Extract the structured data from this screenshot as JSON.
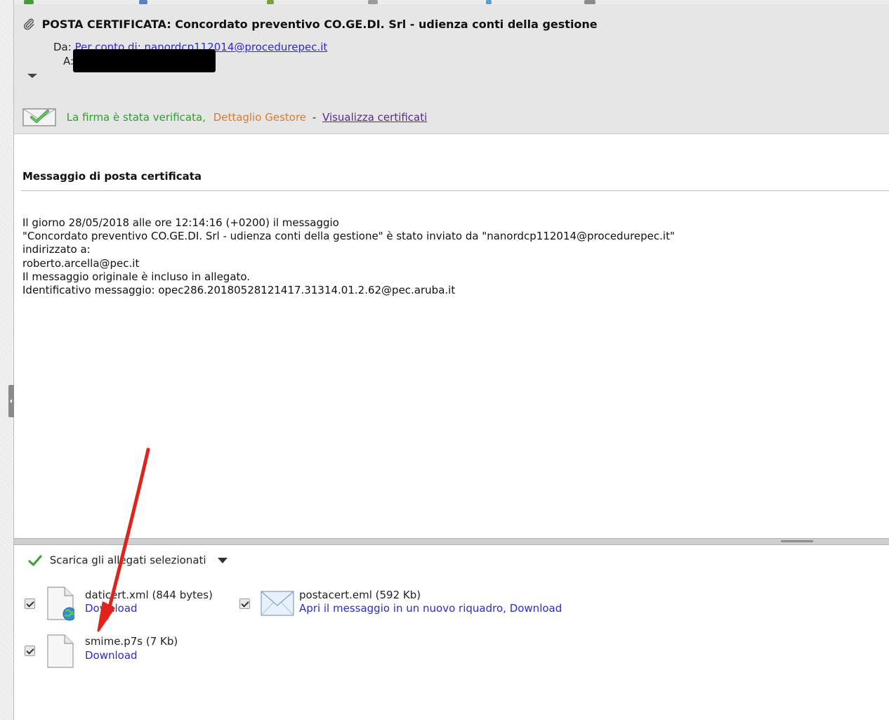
{
  "header": {
    "subject": "POSTA CERTIFICATA: Concordato preventivo CO.GE.DI. Srl - udienza conti della gestione",
    "from_label": "Da:",
    "from_value": "Per conto di: nanordcp112014@procedurepec.it",
    "to_label": "A:"
  },
  "signature": {
    "verified_text": "La firma è stata verificata,",
    "dettaglio_link": "Dettaglio Gestore",
    "separator": "-",
    "certificati_link": "Visualizza certificati"
  },
  "message": {
    "section_title": "Messaggio di posta certificata",
    "lines": [
      "Il giorno 28/05/2018 alle ore 12:14:16 (+0200) il messaggio",
      "\"Concordato preventivo CO.GE.DI. Srl - udienza conti della gestione\" è stato inviato da \"nanordcp112014@procedurepec.it\"",
      "indirizzato a:",
      "roberto.arcella@pec.it",
      "Il messaggio originale è incluso in allegato.",
      "Identificativo messaggio: opec286.20180528121417.31314.01.2.62@pec.aruba.it"
    ]
  },
  "attachments": {
    "download_selected_label": "Scarica gli allegati selezionati",
    "items": [
      {
        "name": "daticert.xml (844 bytes)",
        "download": "Download",
        "checked": true,
        "icon": "xml-file-globe-icon"
      },
      {
        "name": "postacert.eml (592 Kb)",
        "open": "Apri il messaggio in un nuovo riquadro",
        "comma": ", ",
        "download": "Download",
        "checked": true,
        "icon": "envelope-icon"
      },
      {
        "name": "smime.p7s (7 Kb)",
        "download": "Download",
        "checked": true,
        "icon": "blank-file-icon"
      }
    ]
  },
  "colors": {
    "header_bg": "#e6e6e6",
    "link_blue": "#2b2bd0",
    "verified_green": "#2e9e2e",
    "dettaglio_orange": "#e07a2a",
    "visited_purple": "#5b2a86",
    "annotation_arrow": "#e0241b"
  }
}
